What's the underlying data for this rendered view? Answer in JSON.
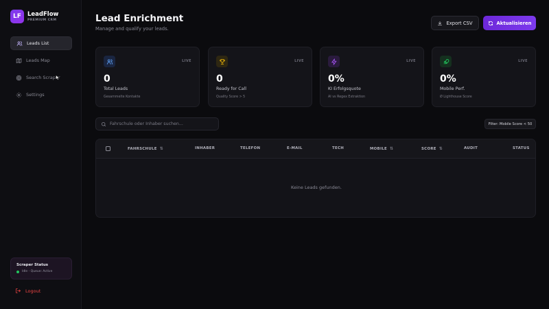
{
  "brand": {
    "logo": "LF",
    "name": "LeadFlow",
    "tagline": "PREMIUM CRM"
  },
  "sidebar": {
    "items": [
      {
        "label": "Leads List",
        "icon": "users-icon",
        "active": true
      },
      {
        "label": "Leads Map",
        "icon": "map-icon",
        "active": false
      },
      {
        "label": "Search Scraper",
        "icon": "target-icon",
        "active": false
      },
      {
        "label": "Settings",
        "icon": "gear-icon",
        "active": false
      }
    ],
    "status": {
      "title": "Scraper Status",
      "text": "Idle - Queue: Active",
      "color": "#22c55e"
    },
    "logout": "Logout"
  },
  "header": {
    "title": "Lead Enrichment",
    "subtitle": "Manage and qualify your leads.",
    "export_label": "Export CSV",
    "refresh_label": "Aktualisieren",
    "accent": "#7c3aed"
  },
  "stats": [
    {
      "icon": "users-icon",
      "live": "LIVE",
      "value": "0",
      "label": "Total Leads",
      "sub": "Gesammelte Kontakte",
      "color": "#60a5fa"
    },
    {
      "icon": "trophy-icon",
      "live": "LIVE",
      "value": "0",
      "label": "Ready for Call",
      "sub": "Quality Score > 5",
      "color": "#eab308"
    },
    {
      "icon": "bolt-icon",
      "live": "LIVE",
      "value": "0%",
      "label": "KI Erfolgsquote",
      "sub": "AI vs Regex Extraktion",
      "color": "#a855f7"
    },
    {
      "icon": "rocket-icon",
      "live": "LIVE",
      "value": "0%",
      "label": "Mobile Perf.",
      "sub": "Ø Lighthouse Score",
      "color": "#22c55e"
    }
  ],
  "search": {
    "placeholder": "Fahrschule oder Inhaber suchen..."
  },
  "filter_label": "Filter: Mobile Score < 50",
  "table": {
    "columns": [
      "FAHRSCHULE",
      "INHABER",
      "TELEFON",
      "E-MAIL",
      "TECH",
      "MOBILE",
      "SCORE",
      "AUDIT",
      "STATUS"
    ],
    "sort_glyph": "⇅",
    "empty_text": "Keine Leads gefunden."
  }
}
